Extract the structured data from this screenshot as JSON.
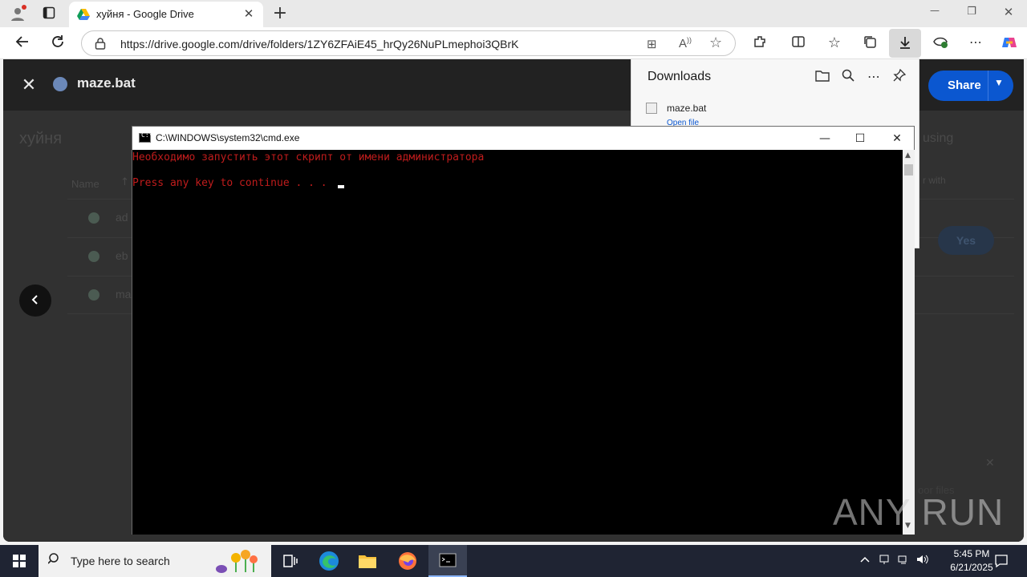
{
  "browser": {
    "tab_title": "хуйня - Google Drive",
    "tab_close": "✕",
    "new_tab": "+",
    "url": "https://drive.google.com/drive/folders/1ZY6ZFAiE45_hrQy26NuPLmephoi3QBrK",
    "window_minimize": "—",
    "window_restore": "❐",
    "window_close": "✕"
  },
  "downloads": {
    "header": "Downloads",
    "item_name": "maze.bat",
    "item_action": "Open file"
  },
  "drive": {
    "preview_filename": "maze.bat",
    "share_label": "Share",
    "folder_title": "хуйня",
    "column_name": "Name",
    "sort_arrow": "↑",
    "rows": [
      {
        "name": "ad"
      },
      {
        "name": "eb"
      },
      {
        "name": "ma"
      }
    ],
    "side_text_1": "using",
    "side_text_2": "r with",
    "yes_label": "Yes",
    "side_text_3": "oor files"
  },
  "cmd": {
    "title": "C:\\WINDOWS\\system32\\cmd.exe",
    "line1": "Необходимо запустить этот скрипт от имени администратора",
    "line2": "Press any key to continue . . .",
    "text_color": "#c01c1c"
  },
  "watermark": "ANY RUN",
  "taskbar": {
    "search_placeholder": "Type here to search",
    "time": "5:45 PM",
    "date": "6/21/2025"
  }
}
